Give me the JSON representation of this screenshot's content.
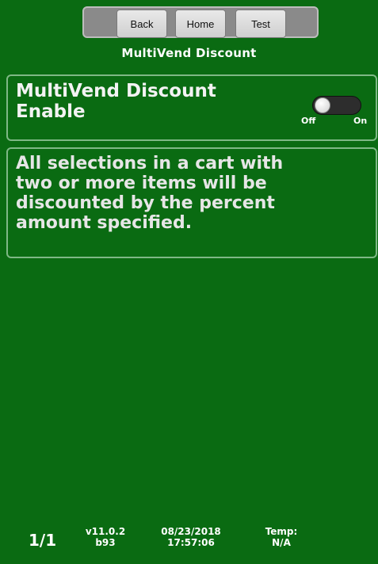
{
  "nav": {
    "back": "Back",
    "home": "Home",
    "test": "Test"
  },
  "title": "MultiVend Discount",
  "enable": {
    "label": "MultiVend Discount Enable",
    "toggle_off": "Off",
    "toggle_on": "On",
    "state": "off"
  },
  "description": "All selections in a cart with two or more items will be discounted by the percent amount specified.",
  "footer": {
    "page": "1/1",
    "version": "v11.0.2",
    "build": "b93",
    "date": "08/23/2018",
    "time": "17:57:06",
    "temp_label": "Temp:",
    "temp_value": "N/A"
  },
  "colors": {
    "background": "#0a6b12",
    "panel_border": "#7fb886",
    "text": "#ffffff"
  }
}
